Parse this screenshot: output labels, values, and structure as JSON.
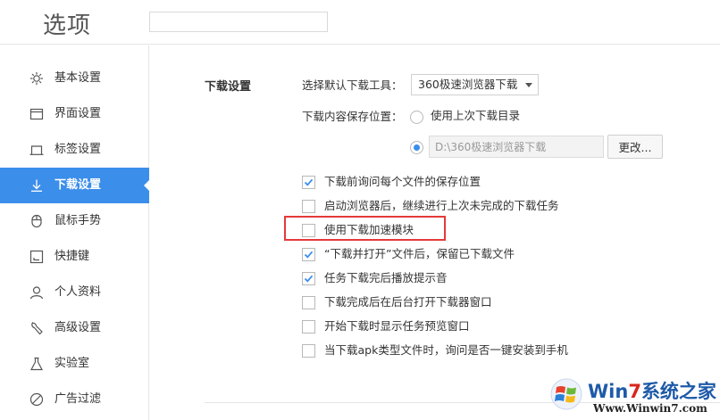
{
  "header": {
    "title": "选项",
    "search_placeholder": ""
  },
  "sidebar": {
    "items": [
      {
        "label": "基本设置",
        "icon": "gear-icon"
      },
      {
        "label": "界面设置",
        "icon": "window-icon"
      },
      {
        "label": "标签设置",
        "icon": "tab-icon"
      },
      {
        "label": "下载设置",
        "icon": "download-icon",
        "active": true
      },
      {
        "label": "鼠标手势",
        "icon": "mouse-icon"
      },
      {
        "label": "快捷键",
        "icon": "shortcut-icon"
      },
      {
        "label": "个人资料",
        "icon": "user-icon"
      },
      {
        "label": "高级设置",
        "icon": "wrench-icon"
      },
      {
        "label": "实验室",
        "icon": "flask-icon"
      },
      {
        "label": "广告过滤",
        "icon": "block-icon"
      }
    ]
  },
  "download": {
    "section_title": "下载设置",
    "tool_label": "选择默认下载工具：",
    "tool_value": "360极速浏览器下载",
    "save_location_label": "下载内容保存位置：",
    "use_last_dir_label": "使用上次下载目录",
    "use_last_dir_selected": false,
    "custom_dir_selected": true,
    "custom_dir_path": "D:\\360极速浏览器下载",
    "change_button": "更改...",
    "options": [
      {
        "label": "下载前询问每个文件的保存位置",
        "checked": true
      },
      {
        "label": "启动浏览器后，继续进行上次未完成的下载任务",
        "checked": false
      },
      {
        "label": "使用下载加速模块",
        "checked": false
      },
      {
        "label": "“下载并打开”文件后，保留已下载文件",
        "checked": true
      },
      {
        "label": "任务下载完后播放提示音",
        "checked": true
      },
      {
        "label": "下载完成后在后台打开下载器窗口",
        "checked": false
      },
      {
        "label": "开始下载时显示任务预览窗口",
        "checked": false
      },
      {
        "label": "当下载apk类型文件时，询问是否一键安装到手机",
        "checked": false
      }
    ]
  },
  "watermark": {
    "brand_prefix": "Win",
    "brand_seven": "7",
    "brand_suffix": "系统之家",
    "url": "Www.Winwin7.com"
  },
  "colors": {
    "accent": "#3b8eea",
    "highlight": "#e53a3a"
  }
}
